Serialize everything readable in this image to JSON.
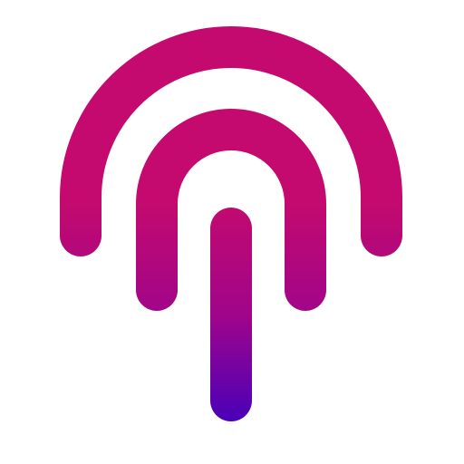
{
  "icon": {
    "name": "fingerprint-touch-icon",
    "colors": {
      "background": "#ffffff",
      "gradient_top": "#c40a6e",
      "gradient_mid": "#a0058a",
      "gradient_bottom": "#4a00b8"
    }
  }
}
